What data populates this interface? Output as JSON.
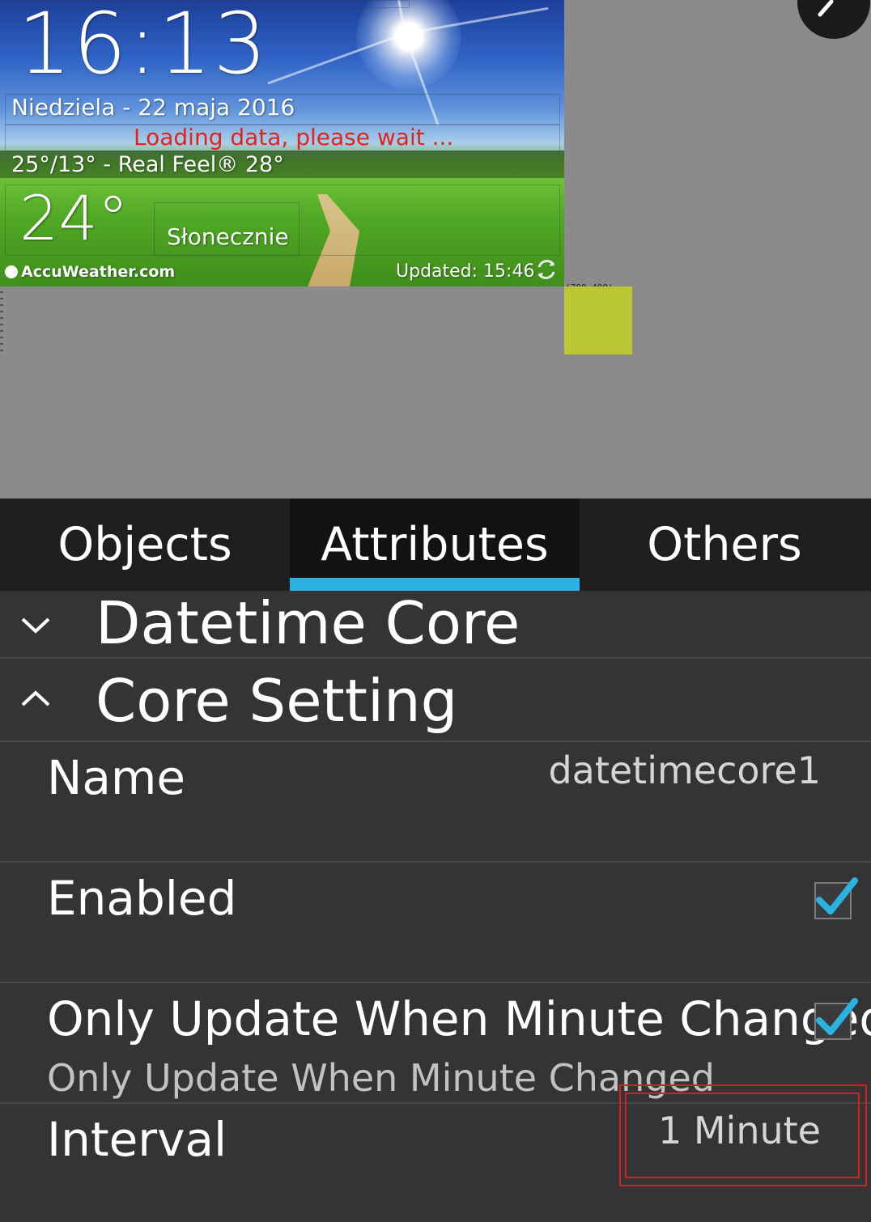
{
  "widget": {
    "time": "16:13",
    "date": "Niedziela - 22 maja 2016",
    "loading": "Loading data, please wait ...",
    "temps": "25°/13° - Real Feel® 28°",
    "current_temp": "24°",
    "condition": "Słonecznie",
    "brand": "AccuWeather.com",
    "updated": "Updated: 15:46"
  },
  "canvas": {
    "coord_label": "(700,400)",
    "handle_color": "#bcc833"
  },
  "tabs": [
    {
      "label": "Objects",
      "active": false
    },
    {
      "label": "Attributes",
      "active": true
    },
    {
      "label": "Others",
      "active": false
    }
  ],
  "sections": {
    "datetime_core": {
      "title": "Datetime Core",
      "expanded": false
    },
    "core_setting": {
      "title": "Core Setting",
      "expanded": true
    }
  },
  "rows": {
    "name": {
      "label": "Name",
      "value": "datetimecore1"
    },
    "enabled": {
      "label": "Enabled",
      "checked": true
    },
    "only_update": {
      "label": "Only Update When Minute Changed",
      "sublabel": "Only Update When Minute Changed",
      "checked": true
    },
    "interval": {
      "label": "Interval",
      "value": "1 Minute"
    }
  },
  "colors": {
    "accent": "#2bb2e3",
    "highlight": "#e01b1b",
    "loading_text": "#e0241c"
  }
}
